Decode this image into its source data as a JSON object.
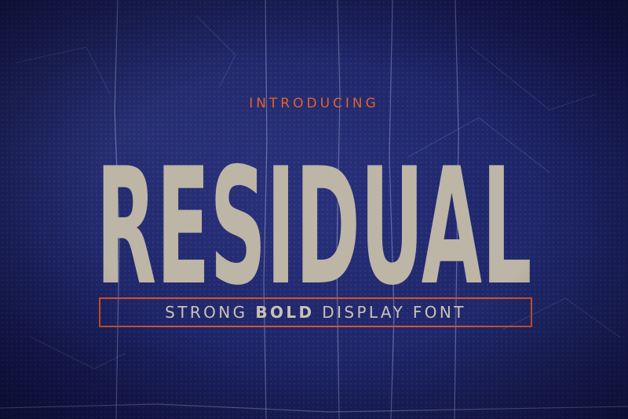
{
  "intro_text": "INTRODUCING",
  "title_text": "RESIDUAL",
  "tagline": {
    "prefix": "STRONG ",
    "bold": "BOLD",
    "suffix": " DISPLAY FONT"
  },
  "colors": {
    "background": "#1b2163",
    "title": "#bdb5a6",
    "accent": "#e0622c",
    "tagline_text": "#c9c2b5"
  }
}
